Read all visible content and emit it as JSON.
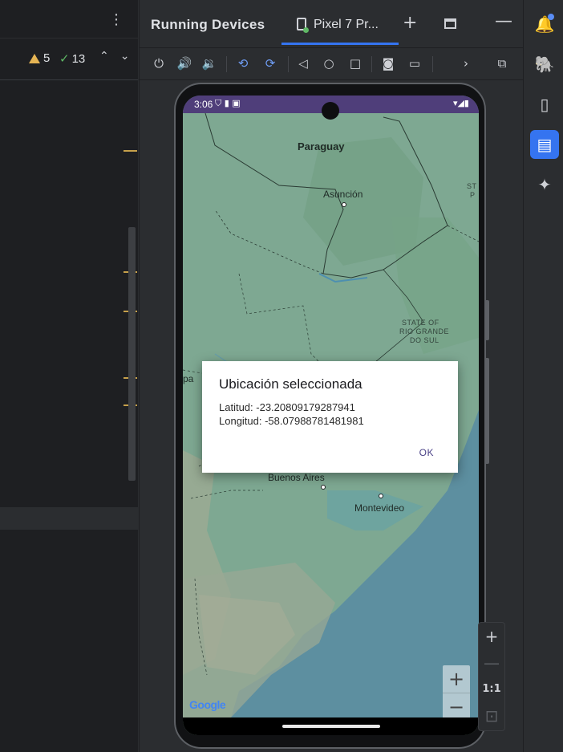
{
  "editor": {
    "more_icon": "kebab-icon",
    "warnings_count": "5",
    "checks_count": "13"
  },
  "panel": {
    "title": "Running Devices",
    "device_tab": "Pixel 7 Pr...",
    "add_icon": "+",
    "minimize_icon": "—"
  },
  "toolbar": {
    "buttons": [
      "power-icon",
      "volume-up-icon",
      "volume-down-icon",
      "rotate-left-icon",
      "rotate-right-icon",
      "back-icon",
      "home-icon",
      "overview-icon",
      "screenshot-icon",
      "screen-record-icon",
      "more-icon",
      "device-mirror-icon"
    ]
  },
  "status_bar": {
    "time": "3:06",
    "left_icons": "⛉ ▮ ▣",
    "right_icons": "▾◢▮"
  },
  "map": {
    "labels": {
      "paraguay": "Paraguay",
      "asuncion": "Asunción",
      "state_rgs_1": "STATE OF",
      "state_rgs_2": "RIO GRANDE",
      "state_rgs_3": "DO SUL",
      "buenos_aires": "Buenos Aires",
      "montevideo": "Montevideo",
      "left_cut": "pa",
      "right_cut_1": "ST",
      "right_cut_2": "P"
    },
    "attribution": "Google",
    "zoom_in": "+",
    "zoom_out": "−"
  },
  "dialog": {
    "title": "Ubicación seleccionada",
    "latitude": "Latitud: -23.20809179287941",
    "longitude": "Longitud: -58.07988781481981",
    "ok": "OK"
  },
  "floating_zoom": {
    "zoom_in": "+",
    "zoom_out": "—",
    "actual_size": "1:1",
    "fit": "⊡"
  },
  "right_toolbar": {
    "icons": [
      "notifications-icon",
      "gradle-icon",
      "device-manager-icon",
      "running-devices-icon",
      "gemini-icon"
    ]
  },
  "colors": {
    "accent": "#3574f0",
    "warning": "#e5b454",
    "success": "#5fb865",
    "status_bar": "#4f3e7a",
    "dialog_button": "#4a4187"
  }
}
